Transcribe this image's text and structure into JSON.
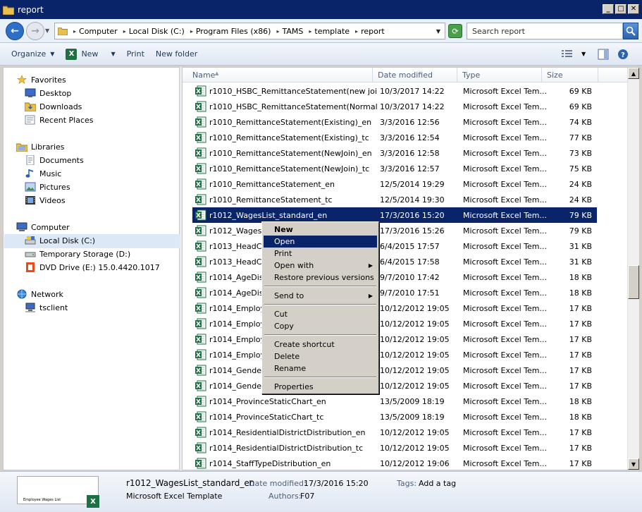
{
  "window": {
    "title": "report"
  },
  "address": {
    "breadcrumbs": [
      "Computer",
      "Local Disk (C:)",
      "Program Files (x86)",
      "TAMS",
      "template",
      "report"
    ],
    "search_placeholder": "Search report"
  },
  "toolbar": {
    "organize": "Organize",
    "new": "New",
    "print": "Print",
    "new_folder": "New folder"
  },
  "nav": {
    "favorites": {
      "label": "Favorites",
      "items": [
        "Desktop",
        "Downloads",
        "Recent Places"
      ]
    },
    "libraries": {
      "label": "Libraries",
      "items": [
        "Documents",
        "Music",
        "Pictures",
        "Videos"
      ]
    },
    "computer": {
      "label": "Computer",
      "items": [
        "Local Disk (C:)",
        "Temporary Storage (D:)",
        "DVD Drive (E:) 15.0.4420.1017"
      ]
    },
    "network": {
      "label": "Network",
      "items": [
        "tsclient"
      ]
    }
  },
  "columns": {
    "name": "Name",
    "date": "Date modified",
    "type": "Type",
    "size": "Size"
  },
  "files": [
    {
      "name": "r1010_HSBC_RemittanceStatement(new join)",
      "date": "10/3/2017 14:22",
      "type": "Microsoft Excel Tem...",
      "size": "69 KB"
    },
    {
      "name": "r1010_HSBC_RemittanceStatement(Normal)",
      "date": "10/3/2017 14:22",
      "type": "Microsoft Excel Tem...",
      "size": "69 KB"
    },
    {
      "name": "r1010_RemittanceStatement(Existing)_en",
      "date": "3/3/2016 12:56",
      "type": "Microsoft Excel Tem...",
      "size": "74 KB"
    },
    {
      "name": "r1010_RemittanceStatement(Existing)_tc",
      "date": "3/3/2016 12:54",
      "type": "Microsoft Excel Tem...",
      "size": "77 KB"
    },
    {
      "name": "r1010_RemittanceStatement(NewJoin)_en",
      "date": "3/3/2016 12:58",
      "type": "Microsoft Excel Tem...",
      "size": "73 KB"
    },
    {
      "name": "r1010_RemittanceStatement(NewJoin)_tc",
      "date": "3/3/2016 12:57",
      "type": "Microsoft Excel Tem...",
      "size": "75 KB"
    },
    {
      "name": "r1010_RemittanceStatement_en",
      "date": "12/5/2014 19:29",
      "type": "Microsoft Excel Tem...",
      "size": "24 KB"
    },
    {
      "name": "r1010_RemittanceStatement_tc",
      "date": "12/5/2014 19:30",
      "type": "Microsoft Excel Tem...",
      "size": "24 KB"
    },
    {
      "name": "r1012_WagesList_standard_en",
      "date": "17/3/2016 15:20",
      "type": "Microsoft Excel Tem...",
      "size": "79 KB",
      "selected": true
    },
    {
      "name": "r1012_WagesLis",
      "date": "17/3/2016 15:26",
      "type": "Microsoft Excel Tem...",
      "size": "79 KB"
    },
    {
      "name": "r1013_HeadCou",
      "date": "6/4/2015 17:57",
      "type": "Microsoft Excel Tem...",
      "size": "31 KB"
    },
    {
      "name": "r1013_HeadCou",
      "date": "6/4/2015 17:58",
      "type": "Microsoft Excel Tem...",
      "size": "31 KB"
    },
    {
      "name": "r1014_AgeDistri",
      "date": "9/7/2010 17:42",
      "type": "Microsoft Excel Tem...",
      "size": "18 KB"
    },
    {
      "name": "r1014_AgeDistri",
      "date": "9/7/2010 17:51",
      "type": "Microsoft Excel Tem...",
      "size": "18 KB"
    },
    {
      "name": "r1014_Employee",
      "date": "10/12/2012 19:05",
      "type": "Microsoft Excel Tem...",
      "size": "17 KB"
    },
    {
      "name": "r1014_Employee",
      "date": "10/12/2012 19:05",
      "type": "Microsoft Excel Tem...",
      "size": "17 KB"
    },
    {
      "name": "r1014_Employee",
      "date": "10/12/2012 19:05",
      "type": "Microsoft Excel Tem...",
      "size": "17 KB"
    },
    {
      "name": "r1014_Employee",
      "date": "10/12/2012 19:05",
      "type": "Microsoft Excel Tem...",
      "size": "17 KB"
    },
    {
      "name": "r1014_GenderD",
      "date": "10/12/2012 19:05",
      "type": "Microsoft Excel Tem...",
      "size": "17 KB"
    },
    {
      "name": "r1014_GenderD",
      "date": "10/12/2012 19:05",
      "type": "Microsoft Excel Tem...",
      "size": "17 KB"
    },
    {
      "name": "r1014_ProvinceStaticChart_en",
      "date": "13/5/2009 18:19",
      "type": "Microsoft Excel Tem...",
      "size": "18 KB"
    },
    {
      "name": "r1014_ProvinceStaticChart_tc",
      "date": "13/5/2009 18:19",
      "type": "Microsoft Excel Tem...",
      "size": "18 KB"
    },
    {
      "name": "r1014_ResidentialDistrictDistribution_en",
      "date": "10/12/2012 19:05",
      "type": "Microsoft Excel Tem...",
      "size": "17 KB"
    },
    {
      "name": "r1014_ResidentialDistrictDistribution_tc",
      "date": "10/12/2012 19:05",
      "type": "Microsoft Excel Tem...",
      "size": "17 KB"
    },
    {
      "name": "r1014_StaffTypeDistribution_en",
      "date": "10/12/2012 19:06",
      "type": "Microsoft Excel Tem...",
      "size": "17 KB"
    }
  ],
  "context_menu": {
    "new": "New",
    "open": "Open",
    "print": "Print",
    "open_with": "Open with",
    "restore": "Restore previous versions",
    "send_to": "Send to",
    "cut": "Cut",
    "copy": "Copy",
    "create_shortcut": "Create shortcut",
    "delete": "Delete",
    "rename": "Rename",
    "properties": "Properties"
  },
  "details": {
    "filename": "r1012_WagesList_standard_en",
    "date_label": "Date modified:",
    "date_value": "17/3/2016 15:20",
    "tags_label": "Tags:",
    "tags_value": "Add a tag",
    "filetype": "Microsoft Excel Template",
    "authors_label": "Authors:",
    "authors_value": "F07",
    "thumb_text": "Employee Wages List"
  },
  "colors": {
    "selection": "#0a246a",
    "title_bar": "#0a246a",
    "excel": "#1d7044"
  }
}
